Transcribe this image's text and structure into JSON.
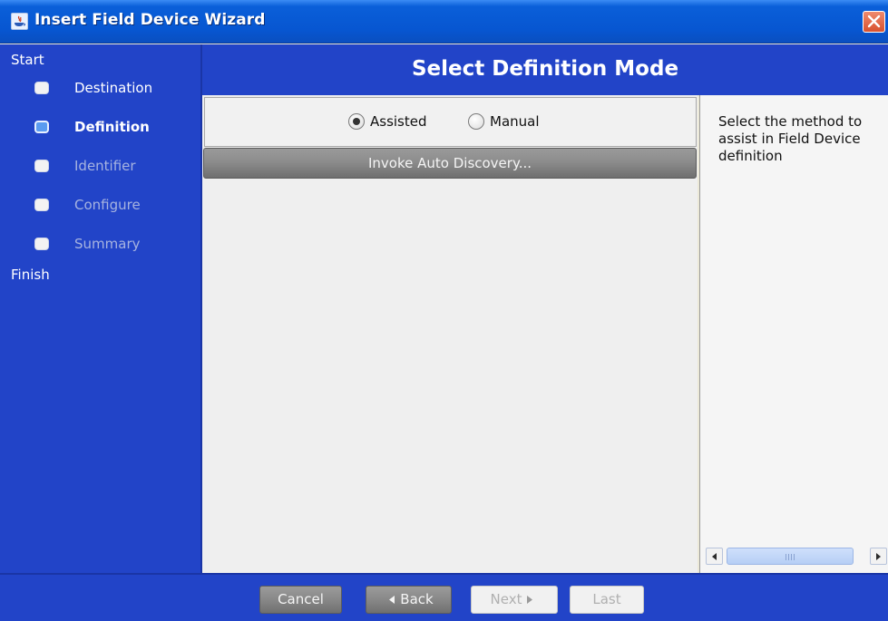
{
  "window": {
    "title": "Insert Field Device Wizard",
    "close_icon": "close-icon"
  },
  "nav": {
    "start_label": "Start",
    "finish_label": "Finish",
    "steps": [
      {
        "label": "Destination",
        "state": "done"
      },
      {
        "label": "Definition",
        "state": "current"
      },
      {
        "label": "Identifier",
        "state": "pending"
      },
      {
        "label": "Configure",
        "state": "pending"
      },
      {
        "label": "Summary",
        "state": "pending"
      }
    ]
  },
  "header": {
    "title": "Select Definition Mode"
  },
  "mode": {
    "options": [
      {
        "label": "Assisted",
        "selected": true
      },
      {
        "label": "Manual",
        "selected": false
      }
    ],
    "invoke_button": "Invoke Auto Discovery..."
  },
  "help": {
    "text": "Select the method to assist in Field Device definition"
  },
  "footer": {
    "cancel": "Cancel",
    "back": "Back",
    "next": "Next",
    "last": "Last"
  },
  "colors": {
    "nav_background": "#2244c8",
    "titlebar": "#0756d1",
    "close_button": "#d8512e"
  }
}
